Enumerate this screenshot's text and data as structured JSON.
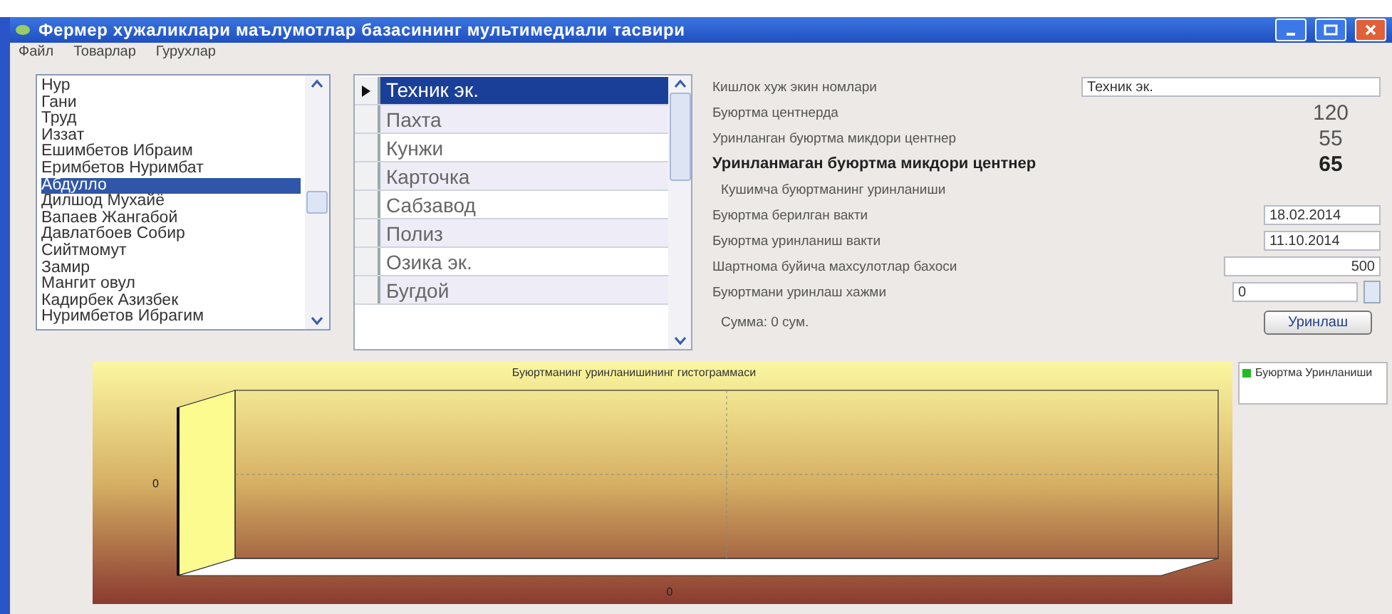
{
  "window": {
    "title": "Фермер хужаликлари маълумотлар базасининг мультимедиали тасвири"
  },
  "menu": [
    "Файл",
    "Товарлар",
    "Гурухлар"
  ],
  "farmers": [
    {
      "label": "Нур",
      "selected": false
    },
    {
      "label": "Гани",
      "selected": false
    },
    {
      "label": "Труд",
      "selected": false
    },
    {
      "label": "Иззат",
      "selected": false
    },
    {
      "label": "Ешимбетов Ибраим",
      "selected": false
    },
    {
      "label": "Еримбетов Нуримбат",
      "selected": false
    },
    {
      "label": "Абдулло",
      "selected": true
    },
    {
      "label": "Дилшод Мухайё",
      "selected": false
    },
    {
      "label": "Вапаев Жангабой",
      "selected": false
    },
    {
      "label": "Давлатбоев Собир",
      "selected": false
    },
    {
      "label": "Сийтмомут",
      "selected": false
    },
    {
      "label": "Замир",
      "selected": false
    },
    {
      "label": "Мангит овул",
      "selected": false
    },
    {
      "label": "Кадирбек Азизбек",
      "selected": false
    },
    {
      "label": "Нуримбетов Ибрагим",
      "selected": false
    }
  ],
  "crops": [
    {
      "label": "Техник эк.",
      "selected": true
    },
    {
      "label": "Пахта",
      "selected": false
    },
    {
      "label": "Кунжи",
      "selected": false
    },
    {
      "label": "Карточка",
      "selected": false
    },
    {
      "label": "Сабзавод",
      "selected": false
    },
    {
      "label": "Полиз",
      "selected": false
    },
    {
      "label": "Озика эк.",
      "selected": false
    },
    {
      "label": "Бугдой",
      "selected": false
    }
  ],
  "details": [
    {
      "kind": "field",
      "label": "Кишлок хуж экин номлари",
      "value": "Техник эк."
    },
    {
      "kind": "number",
      "label": "Буюртма центнерда",
      "value": "120"
    },
    {
      "kind": "number",
      "label": "Уринланган буюртма микдори центнер",
      "value": "55"
    },
    {
      "kind": "bold",
      "label": "Уринланмаган буюртма микдори центнер",
      "value": "65"
    },
    {
      "kind": "note",
      "label": "Кушимча буюртманинг уринланиши"
    },
    {
      "kind": "date",
      "label": "Буюртма берилган вакти",
      "value": "18.02.2014"
    },
    {
      "kind": "date",
      "label": "Буюртма уринланиш вакти",
      "value": "11.10.2014"
    },
    {
      "kind": "amount",
      "label": "Шартнома буйича махсулотлар бахоси",
      "value": "500"
    },
    {
      "kind": "spin",
      "label": "Буюртмани уринлаш хажми",
      "value": "0"
    }
  ],
  "sum": "Сумма: 0 сум.",
  "button": "Уринлаш",
  "chart": {
    "title": "Буюртманинг уринланишининг гистограммаси",
    "y_tick": "0",
    "x_tick": "0",
    "legend": {
      "label": "Буюртма Уринланиши",
      "color": "#22bb22"
    }
  }
}
